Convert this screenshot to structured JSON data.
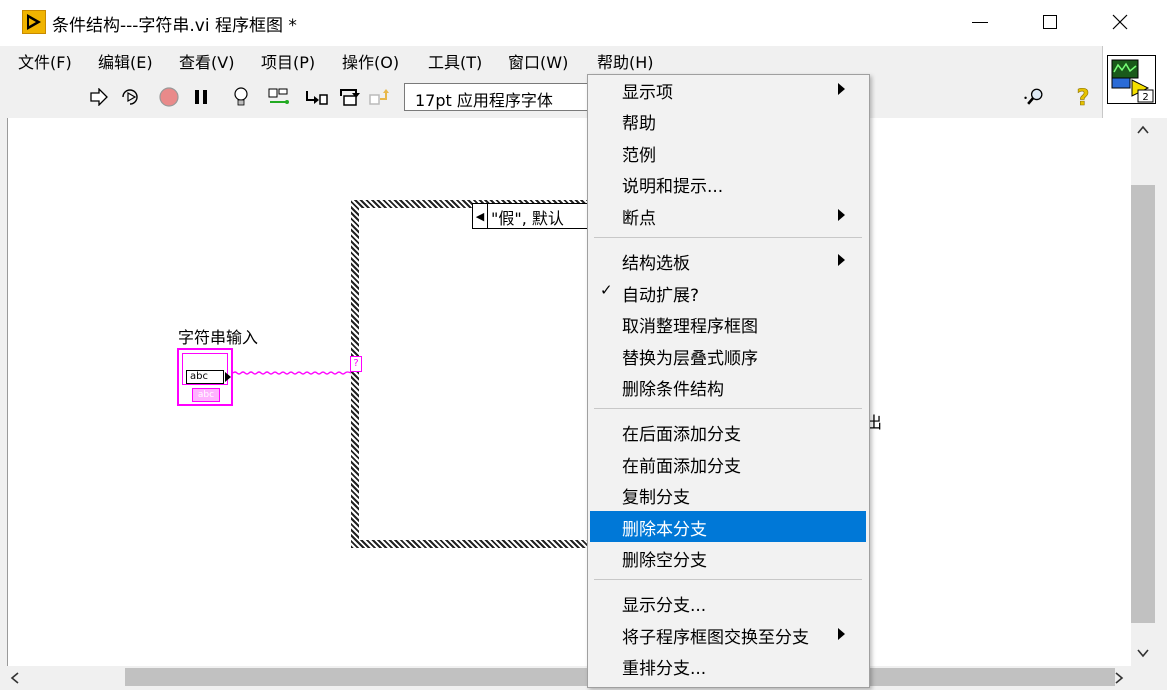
{
  "window": {
    "title": "条件结构---字符串.vi 程序框图 *",
    "controls": {
      "minimize": "minimize-icon",
      "maximize": "maximize-icon",
      "close": "close-icon"
    }
  },
  "menubar": [
    {
      "label": "文件(F)"
    },
    {
      "label": "编辑(E)"
    },
    {
      "label": "查看(V)"
    },
    {
      "label": "项目(P)"
    },
    {
      "label": "操作(O)"
    },
    {
      "label": "工具(T)"
    },
    {
      "label": "窗口(W)"
    },
    {
      "label": "帮助(H)"
    }
  ],
  "toolbar": {
    "font_select": "17pt 应用程序字体",
    "icons": [
      "run-arrow-icon",
      "run-continuous-icon",
      "abort-icon",
      "pause-icon",
      "highlight-execution-icon",
      "retain-wire-values-icon",
      "step-into-icon",
      "step-over-icon",
      "step-out-icon",
      "search-icon",
      "context-help-icon"
    ],
    "vi_icon_connector": "2"
  },
  "diagram": {
    "case_selector": "\"假\", 默认",
    "selector_terminal": "?",
    "string_control_label": "字符串输入",
    "string_control_text": "abc",
    "string_control_sub": "abc",
    "partial_label": "出"
  },
  "context_menu": {
    "groups": [
      [
        {
          "label": "显示项",
          "submenu": true
        },
        {
          "label": "帮助"
        },
        {
          "label": "范例"
        },
        {
          "label": "说明和提示..."
        },
        {
          "label": "断点",
          "submenu": true
        }
      ],
      [
        {
          "label": "结构选板",
          "submenu": true
        },
        {
          "label": "自动扩展?",
          "checked": true
        },
        {
          "label": "取消整理程序框图"
        },
        {
          "label": "替换为层叠式顺序"
        },
        {
          "label": "删除条件结构"
        }
      ],
      [
        {
          "label": "在后面添加分支"
        },
        {
          "label": "在前面添加分支"
        },
        {
          "label": "复制分支"
        },
        {
          "label": "删除本分支",
          "highlighted": true
        },
        {
          "label": "删除空分支"
        }
      ],
      [
        {
          "label": "显示分支..."
        },
        {
          "label": "将子程序框图交换至分支",
          "submenu": true
        },
        {
          "label": "重排分支..."
        }
      ]
    ],
    "highlight_color": "#0078d7"
  }
}
